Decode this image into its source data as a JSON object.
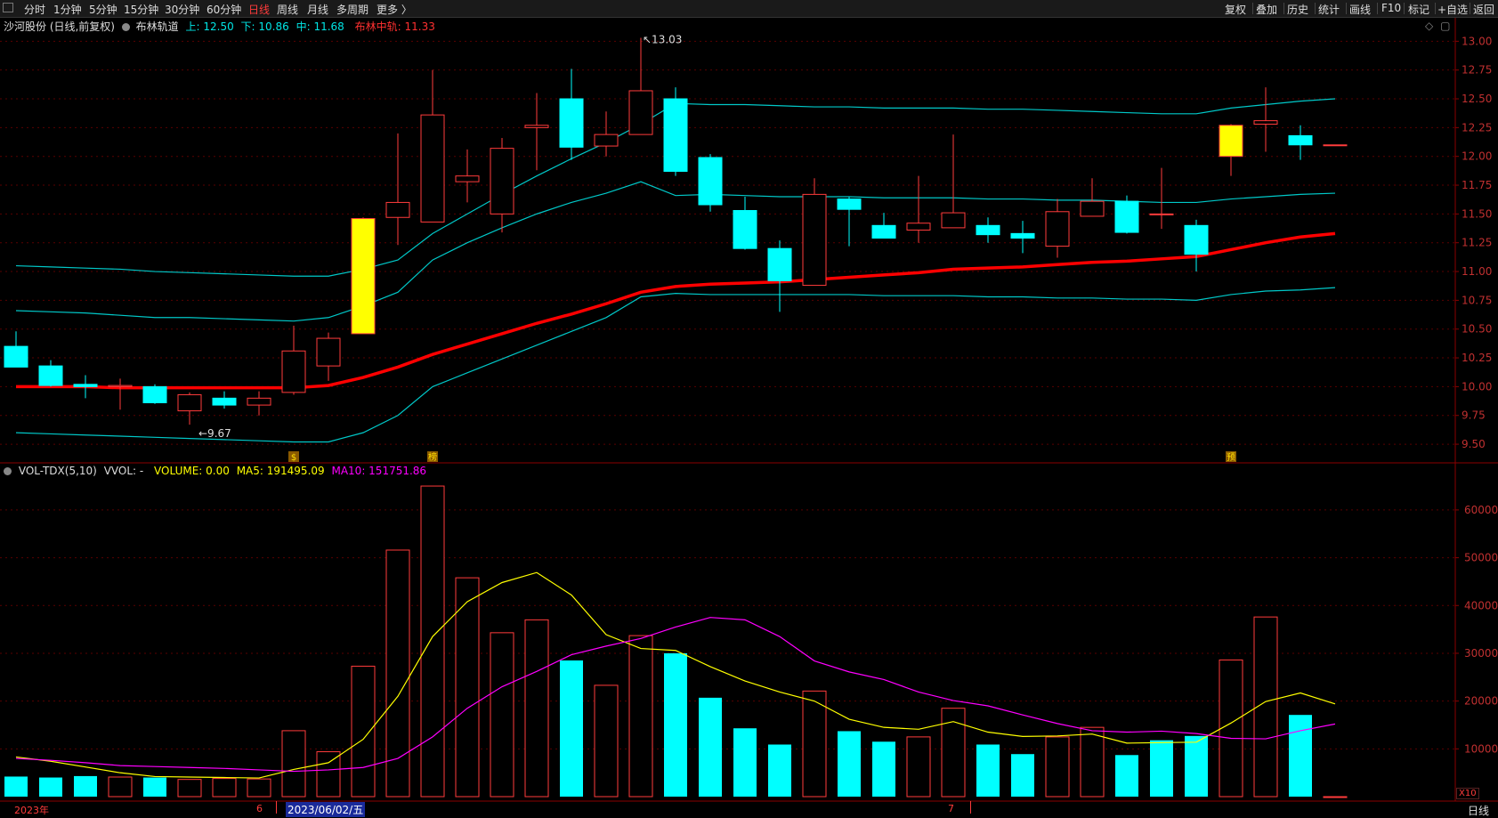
{
  "toolbar": {
    "periods": [
      "分时",
      "1分钟",
      "5分钟",
      "15分钟",
      "30分钟",
      "60分钟",
      "日线",
      "周线",
      "月线",
      "多周期",
      "更多 〉"
    ],
    "active_period": "日线",
    "actions": [
      "复权",
      "叠加",
      "历史",
      "统计",
      "画线",
      "F10",
      "标记",
      "+自选",
      "返回"
    ]
  },
  "price_panel": {
    "stock": "沙河股份 (日线,前复权)",
    "indicator": "布林轨道",
    "upper": "上: 12.50",
    "lower": "下: 10.86",
    "middle": "中: 11.68",
    "mid_label": "布林中轨: 11.33",
    "high_mark": "13.03",
    "low_mark": "9.67",
    "event_marks": [
      "$",
      "榜",
      "预"
    ]
  },
  "volume_panel": {
    "indicator": "VOL-TDX(5,10)",
    "vvol": "VVOL: -",
    "volume": "VOLUME: 0.00",
    "ma5": "MA5: 191495.09",
    "ma10": "MA10: 151751.86",
    "unit": "X10"
  },
  "date_axis": {
    "year": "2023年",
    "month_6": "6",
    "selected_date": "2023/06/02/五",
    "month_7": "7"
  },
  "status_bar": {
    "mode": "日线"
  },
  "colors": {
    "up": "#ff3b3b",
    "down": "#00ffff",
    "upper_band": "#00c8c8",
    "mid_band": "#ff0000",
    "ma5": "#ffff00",
    "ma10": "#ff00ff",
    "highlight": "#ffff00"
  },
  "chart_data": [
    {
      "type": "candlestick",
      "title": "沙河股份 (日线,前复权)",
      "y_ticks": [
        9.5,
        9.75,
        10.0,
        10.25,
        10.5,
        10.75,
        11.0,
        11.25,
        11.5,
        11.75,
        12.0,
        12.25,
        12.5,
        12.75,
        13.0
      ],
      "ylim": [
        9.4,
        13.08
      ],
      "candles": [
        {
          "o": 10.35,
          "h": 10.48,
          "l": 10.17,
          "c": 10.17
        },
        {
          "o": 10.18,
          "h": 10.23,
          "l": 10.0,
          "c": 10.01
        },
        {
          "o": 10.02,
          "h": 10.1,
          "l": 9.9,
          "c": 10.0
        },
        {
          "o": 10.0,
          "h": 10.07,
          "l": 9.8,
          "c": 10.01
        },
        {
          "o": 10.0,
          "h": 10.02,
          "l": 9.85,
          "c": 9.86
        },
        {
          "o": 9.79,
          "h": 9.95,
          "l": 9.67,
          "c": 9.93
        },
        {
          "o": 9.9,
          "h": 9.96,
          "l": 9.81,
          "c": 9.84
        },
        {
          "o": 9.84,
          "h": 9.96,
          "l": 9.75,
          "c": 9.9
        },
        {
          "o": 9.95,
          "h": 10.53,
          "l": 9.93,
          "c": 10.31
        },
        {
          "o": 10.18,
          "h": 10.47,
          "l": 10.05,
          "c": 10.42
        },
        {
          "o": 10.46,
          "h": 11.47,
          "l": 10.46,
          "c": 11.46
        },
        {
          "o": 11.47,
          "h": 12.2,
          "l": 11.23,
          "c": 11.6
        },
        {
          "o": 11.43,
          "h": 12.75,
          "l": 11.43,
          "c": 12.36
        },
        {
          "o": 11.78,
          "h": 12.06,
          "l": 11.6,
          "c": 11.83
        },
        {
          "o": 11.5,
          "h": 12.16,
          "l": 11.34,
          "c": 12.07
        },
        {
          "o": 12.25,
          "h": 12.55,
          "l": 11.88,
          "c": 12.27
        },
        {
          "o": 12.5,
          "h": 12.76,
          "l": 11.97,
          "c": 12.08
        },
        {
          "o": 12.09,
          "h": 12.39,
          "l": 12.0,
          "c": 12.19
        },
        {
          "o": 12.19,
          "h": 13.03,
          "l": 12.19,
          "c": 12.57
        },
        {
          "o": 12.5,
          "h": 12.6,
          "l": 11.83,
          "c": 11.87
        },
        {
          "o": 11.99,
          "h": 12.02,
          "l": 11.52,
          "c": 11.58
        },
        {
          "o": 11.53,
          "h": 11.65,
          "l": 11.19,
          "c": 11.2
        },
        {
          "o": 11.2,
          "h": 11.27,
          "l": 10.65,
          "c": 10.92
        },
        {
          "o": 10.88,
          "h": 11.81,
          "l": 10.88,
          "c": 11.67
        },
        {
          "o": 11.63,
          "h": 11.65,
          "l": 11.22,
          "c": 11.54
        },
        {
          "o": 11.4,
          "h": 11.51,
          "l": 11.29,
          "c": 11.29
        },
        {
          "o": 11.36,
          "h": 11.83,
          "l": 11.25,
          "c": 11.42
        },
        {
          "o": 11.38,
          "h": 12.19,
          "l": 11.38,
          "c": 11.51
        },
        {
          "o": 11.4,
          "h": 11.47,
          "l": 11.25,
          "c": 11.32
        },
        {
          "o": 11.33,
          "h": 11.44,
          "l": 11.16,
          "c": 11.29
        },
        {
          "o": 11.22,
          "h": 11.63,
          "l": 11.12,
          "c": 11.52
        },
        {
          "o": 11.48,
          "h": 11.81,
          "l": 11.48,
          "c": 11.61
        },
        {
          "o": 11.61,
          "h": 11.66,
          "l": 11.33,
          "c": 11.34
        },
        {
          "o": 11.5,
          "h": 11.9,
          "l": 11.37,
          "c": 11.5
        },
        {
          "o": 11.4,
          "h": 11.45,
          "l": 11.0,
          "c": 11.15
        },
        {
          "o": 12.0,
          "h": 12.28,
          "l": 11.83,
          "c": 12.27
        },
        {
          "o": 12.28,
          "h": 12.6,
          "l": 12.04,
          "c": 12.31
        },
        {
          "o": 12.18,
          "h": 12.27,
          "l": 11.97,
          "c": 12.1
        },
        {
          "o": 12.1,
          "h": 12.1,
          "l": 12.1,
          "c": 12.1
        }
      ],
      "highlighted_candles": [
        10,
        35
      ],
      "boll_upper": [
        10.33,
        10.32,
        10.31,
        10.3,
        10.29,
        10.28,
        10.27,
        10.26,
        10.25,
        10.25,
        10.35,
        10.48,
        10.8,
        11.05,
        11.3,
        11.55,
        11.8,
        12.0,
        12.22,
        12.47,
        12.46,
        12.46,
        12.44,
        12.44,
        12.44,
        12.44,
        12.43,
        12.43,
        12.42,
        12.42,
        12.42,
        12.41,
        12.4,
        12.39,
        12.38,
        12.43,
        12.47,
        12.49,
        12.5
      ],
      "boll_mid": [
        10.0,
        10.0,
        10.0,
        9.99,
        9.99,
        9.99,
        9.99,
        9.99,
        9.99,
        10.01,
        10.08,
        10.17,
        10.28,
        10.37,
        10.46,
        10.55,
        10.63,
        10.72,
        10.82,
        10.87,
        10.89,
        10.9,
        10.91,
        10.93,
        10.95,
        10.97,
        10.99,
        11.02,
        11.03,
        11.04,
        11.06,
        11.08,
        11.09,
        11.11,
        11.13,
        11.19,
        11.25,
        11.3,
        11.33
      ],
      "boll_lower": [
        9.6,
        9.59,
        9.58,
        9.57,
        9.56,
        9.55,
        9.54,
        9.53,
        9.52,
        9.52,
        9.6,
        9.75,
        10.0,
        10.12,
        10.24,
        10.36,
        10.48,
        10.6,
        10.78,
        10.81,
        10.8,
        10.8,
        10.8,
        10.8,
        10.8,
        10.79,
        10.79,
        10.79,
        10.78,
        10.78,
        10.77,
        10.77,
        10.76,
        10.76,
        10.75,
        10.8,
        10.83,
        10.84,
        10.86
      ],
      "boll_outer_upper": [
        11.05,
        11.04,
        11.03,
        11.02,
        11.0,
        10.99,
        10.98,
        10.97,
        10.96,
        10.96,
        11.02,
        11.1,
        11.33,
        11.5,
        11.67,
        11.83,
        11.98,
        12.12,
        12.28,
        12.46,
        12.45,
        12.45,
        12.44,
        12.43,
        12.43,
        12.42,
        12.42,
        12.42,
        12.41,
        12.41,
        12.4,
        12.39,
        12.38,
        12.37,
        12.37,
        12.42,
        12.45,
        12.48,
        12.5
      ],
      "boll_inner_upper": [
        10.66,
        10.65,
        10.64,
        10.62,
        10.6,
        10.6,
        10.59,
        10.58,
        10.57,
        10.6,
        10.7,
        10.82,
        11.1,
        11.25,
        11.38,
        11.5,
        11.6,
        11.68,
        11.78,
        11.66,
        11.67,
        11.66,
        11.65,
        11.65,
        11.65,
        11.64,
        11.64,
        11.64,
        11.63,
        11.63,
        11.62,
        11.62,
        11.61,
        11.6,
        11.6,
        11.63,
        11.65,
        11.67,
        11.68
      ]
    },
    {
      "type": "bar",
      "title": "VOL-TDX(5,10)",
      "y_ticks": [
        10000,
        20000,
        30000,
        40000,
        50000,
        60000
      ],
      "ylim": [
        0,
        66500
      ],
      "volumes": [
        4200,
        4000,
        4300,
        4100,
        4000,
        3600,
        3800,
        3700,
        13800,
        9400,
        27300,
        51600,
        65000,
        45800,
        34300,
        37000,
        28500,
        23300,
        33700,
        30000,
        20700,
        14300,
        10900,
        22100,
        13700,
        11500,
        12500,
        18500,
        10900,
        8900,
        12500,
        14500,
        8700,
        11800,
        12700,
        28600,
        37600,
        17100,
        0
      ],
      "volume_up": [
        false,
        false,
        false,
        true,
        false,
        true,
        true,
        true,
        true,
        true,
        true,
        true,
        true,
        true,
        true,
        true,
        false,
        true,
        true,
        false,
        false,
        false,
        false,
        true,
        false,
        false,
        true,
        true,
        false,
        false,
        true,
        true,
        false,
        false,
        false,
        true,
        true,
        false,
        true
      ],
      "ma5": [
        8300,
        7400,
        6200,
        5000,
        4200,
        4100,
        4000,
        3900,
        5700,
        7100,
        12000,
        21000,
        33500,
        40800,
        44800,
        46900,
        42200,
        33900,
        31000,
        30600,
        27200,
        24200,
        21900,
        20000,
        16200,
        14500,
        14100,
        15700,
        13500,
        12600,
        12700,
        13100,
        11200,
        11300,
        11400,
        15400,
        19900,
        21700,
        19400
      ],
      "ma10": [
        8000,
        7600,
        7100,
        6500,
        6300,
        6100,
        5900,
        5600,
        5300,
        5600,
        6100,
        8000,
        12500,
        18500,
        23000,
        26200,
        29700,
        31500,
        33100,
        35500,
        37500,
        37000,
        33500,
        28400,
        26100,
        24500,
        21900,
        20100,
        19000,
        17100,
        15300,
        13800,
        13500,
        13700,
        13200,
        12200,
        12100,
        13800,
        15200
      ]
    }
  ]
}
